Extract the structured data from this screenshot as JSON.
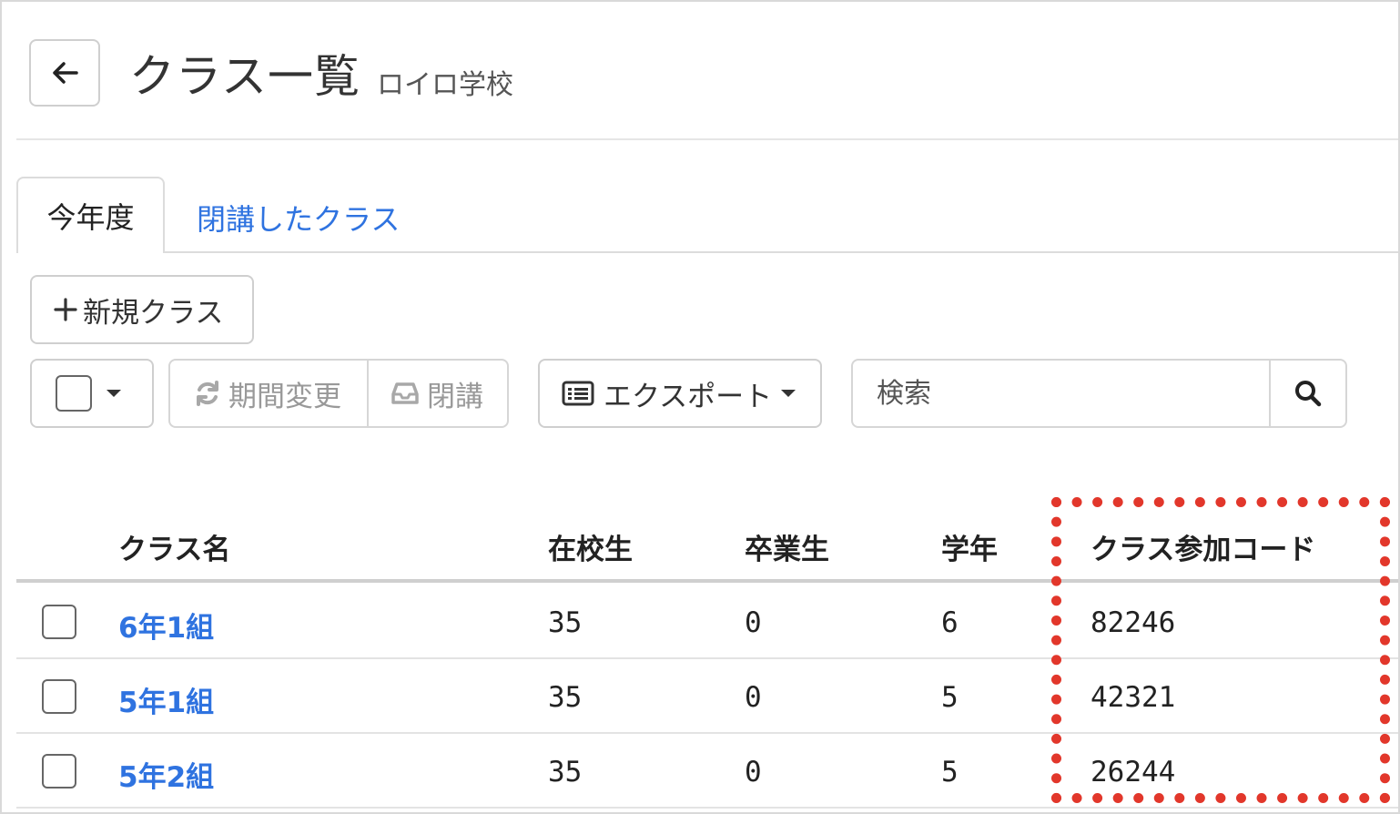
{
  "header": {
    "title": "クラス一覧",
    "school": "ロイロ学校"
  },
  "tabs": [
    {
      "label": "今年度",
      "active": true
    },
    {
      "label": "閉講したクラス",
      "active": false
    }
  ],
  "toolbar": {
    "new_class": "新規クラス",
    "period_change": "期間変更",
    "close": "閉講",
    "export": "エクスポート",
    "search_placeholder": "検索"
  },
  "table": {
    "columns": [
      "クラス名",
      "在校生",
      "卒業生",
      "学年",
      "クラス参加コード"
    ],
    "rows": [
      {
        "name": "6年1組",
        "current": "35",
        "graduates": "0",
        "grade": "6",
        "code": "82246"
      },
      {
        "name": "5年1組",
        "current": "35",
        "graduates": "0",
        "grade": "5",
        "code": "42321"
      },
      {
        "name": "5年2組",
        "current": "35",
        "graduates": "0",
        "grade": "5",
        "code": "26244"
      }
    ]
  },
  "colors": {
    "link": "#2f73e0",
    "highlight": "#e2372b",
    "border": "#cfcfcf"
  }
}
